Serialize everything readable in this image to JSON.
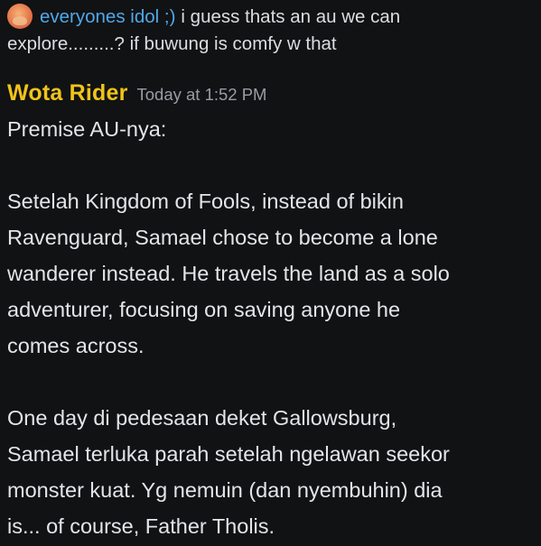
{
  "reply": {
    "avatar_icon": "user-avatar-icon",
    "author": "everyones idol ;)",
    "text_line1": "i guess thats an au we can",
    "text_line2": "explore.........? if buwung is comfy w that"
  },
  "message": {
    "author": "Wota Rider",
    "author_color": "#f0c419",
    "timestamp": "Today at 1:52 PM",
    "lines": [
      "Premise AU-nya:",
      "",
      "Setelah Kingdom of Fools, instead of bikin",
      "Ravenguard, Samael chose to become a lone",
      "wanderer instead. He travels the land as a solo",
      "adventurer, focusing on saving anyone he",
      "comes across.",
      "",
      "One day di pedesaan deket Gallowsburg,",
      "Samael terluka parah setelah ngelawan seekor",
      "monster kuat. Yg nemuin (dan nyembuhin) dia",
      "is... of course, Father Tholis."
    ]
  },
  "colors": {
    "background": "#111214",
    "reply_author": "#4fa8e8",
    "timestamp": "#9a9ca3"
  }
}
